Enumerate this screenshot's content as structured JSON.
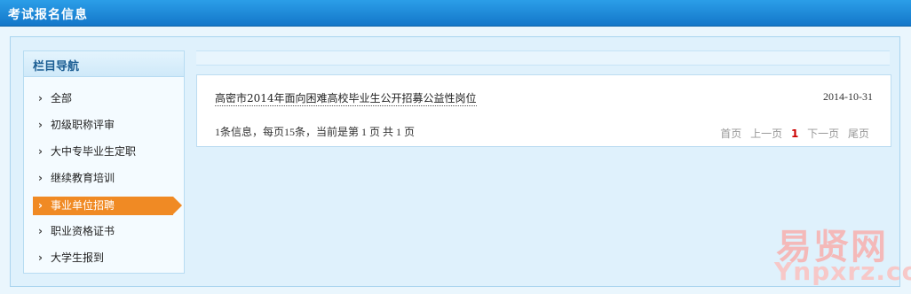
{
  "header": {
    "title": "考试报名信息"
  },
  "sidebar": {
    "title": "栏目导航",
    "items": [
      {
        "label": "全部"
      },
      {
        "label": "初级职称评审"
      },
      {
        "label": "大中专毕业生定职"
      },
      {
        "label": "继续教育培训"
      },
      {
        "label": "事业单位招聘"
      },
      {
        "label": "职业资格证书"
      },
      {
        "label": "大学生报到"
      }
    ],
    "active_index": 4
  },
  "content": {
    "article": {
      "title": "高密市2014年面向困难高校毕业生公开招募公益性岗位",
      "date": "2014-10-31"
    },
    "page_info": "1条信息，每页15条，当前是第  1 页  共  1 页",
    "pager": {
      "first": "首页",
      "prev": "上一页",
      "current": "1",
      "next": "下一页",
      "last": "尾页"
    }
  },
  "watermark": {
    "cn": "易贤网",
    "en": "Ynpxrz.com"
  },
  "colors": {
    "title_bar": "#1a86d6",
    "active_item": "#f08a24",
    "page_current": "#cc0000"
  }
}
